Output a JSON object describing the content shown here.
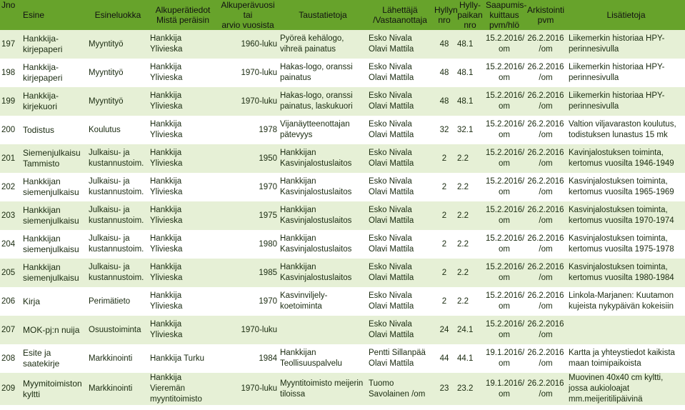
{
  "headers": {
    "jno": "Jno",
    "esine": "Esine",
    "esineluokka": "Esineluokka",
    "alkuperatiedot_1": "Alkuperätiedot",
    "alkuperatiedot_2": "Mistä peräisin",
    "alkuperavuosi_1": "Alkuperävuosi tai",
    "alkuperavuosi_2": "arvio vuosista",
    "taustatietoja": "Taustatietoja",
    "lahettaja_1": "Lähettäjä",
    "lahettaja_2": "/Vastaanottaja",
    "hyllyn_1": "Hyllyn",
    "hyllyn_2": "nro",
    "hyllypaikan_1": "Hylly-",
    "hyllypaikan_2": "paikan",
    "hyllypaikan_3": "nro",
    "saapumis_1": "Saapumis-",
    "saapumis_2": "kuittaus",
    "saapumis_3": "pvm/hlö",
    "arkistointi_1": "Arkistointi",
    "arkistointi_2": "pvm",
    "lisatietoja": "Lisätietoja"
  },
  "rows": [
    {
      "jno": "197",
      "esine": "Hankkija-kirjepaperi",
      "luokka": "Myyntityö",
      "alkupera": "Hankkija Ylivieska",
      "vuosi": "1960-luku",
      "tausta": "Pyöreä kehälogo, vihreä painatus",
      "lahettaja_1": "Esko Nivala",
      "lahettaja_2": "Olavi Mattila",
      "hylly": "48",
      "paikka": "48.1",
      "saapumis_1": "15.2.2016/",
      "saapumis_2": "om",
      "arkisto_1": "26.2.2016",
      "arkisto_2": "/om",
      "lisa": "Liikemerkin historiaa HPY-perinnesivulla"
    },
    {
      "jno": "198",
      "esine": "Hankkija-kirjepaperi",
      "luokka": "Myyntityö",
      "alkupera": "Hankkija Ylivieska",
      "vuosi": "1970-luku",
      "tausta": "Hakas-logo, oranssi painatus",
      "lahettaja_1": "Esko Nivala",
      "lahettaja_2": "Olavi Mattila",
      "hylly": "48",
      "paikka": "48.1",
      "saapumis_1": "15.2.2016/",
      "saapumis_2": "om",
      "arkisto_1": "26.2.2016",
      "arkisto_2": "/om",
      "lisa": "Liikemerkin historiaa HPY-perinnesivulla"
    },
    {
      "jno": "199",
      "esine": "Hankkija-kirjekuori",
      "luokka": "Myyntityö",
      "alkupera": "Hankkija Ylivieska",
      "vuosi": "1970-luku",
      "tausta": "Hakas-logo, oranssi painatus, laskukuori",
      "lahettaja_1": "Esko Nivala",
      "lahettaja_2": "Olavi Mattila",
      "hylly": "48",
      "paikka": "48.1",
      "saapumis_1": "15.2.2016/",
      "saapumis_2": "om",
      "arkisto_1": "26.2.2016",
      "arkisto_2": "/om",
      "lisa": "Liikemerkin historiaa HPY-perinnesivulla"
    },
    {
      "jno": "200",
      "esine": "Todistus",
      "luokka": "Koulutus",
      "alkupera": "Hankkija Ylivieska",
      "vuosi": "1978",
      "tausta": "Vijanäytteenottajan pätevyys",
      "lahettaja_1": "Esko Nivala",
      "lahettaja_2": "Olavi Mattila",
      "hylly": "32",
      "paikka": "32.1",
      "saapumis_1": "15.2.2016/",
      "saapumis_2": "om",
      "arkisto_1": "26.2.2016",
      "arkisto_2": "/om",
      "lisa": "Valtion viljavaraston koulutus, todistuksen lunastus 15 mk"
    },
    {
      "jno": "201",
      "esine": "Siemenjulkaisu Tammisto",
      "luokka": "Julkaisu- ja kustannustoim.",
      "alkupera": "Hankkija Ylivieska",
      "vuosi": "1950",
      "tausta": "Hankkijan Kasvinjalostuslaitos",
      "lahettaja_1": "Esko Nivala",
      "lahettaja_2": "Olavi Mattila",
      "hylly": "2",
      "paikka": "2.2",
      "saapumis_1": "15.2.2016/",
      "saapumis_2": "om",
      "arkisto_1": "26.2.2016",
      "arkisto_2": "/om",
      "lisa": "Kavinjalostuksen toiminta, kertomus vuosilta 1946-1949"
    },
    {
      "jno": "202",
      "esine": "Hankkijan siemenjulkaisu",
      "luokka": "Julkaisu- ja kustannustoim.",
      "alkupera": "Hankkija Ylivieska",
      "vuosi": "1970",
      "tausta": "Hankkijan Kasvinjalostuslaitos",
      "lahettaja_1": "Esko Nivala",
      "lahettaja_2": "Olavi Mattila",
      "hylly": "2",
      "paikka": "2.2",
      "saapumis_1": "15.2.2016/",
      "saapumis_2": "om",
      "arkisto_1": "26.2.2016",
      "arkisto_2": "/om",
      "lisa": "Kasvinjalostuksen toiminta, kertomus vuosilta 1965-1969"
    },
    {
      "jno": "203",
      "esine": "Hankkijan siemenjulkaisu",
      "luokka": "Julkaisu- ja kustannustoim.",
      "alkupera": "Hankkija Ylivieska",
      "vuosi": "1975",
      "tausta": "Hankkijan Kasvinjalostuslaitos",
      "lahettaja_1": "Esko Nivala",
      "lahettaja_2": "Olavi Mattila",
      "hylly": "2",
      "paikka": "2.2",
      "saapumis_1": "15.2.2016/",
      "saapumis_2": "om",
      "arkisto_1": "26.2.2016",
      "arkisto_2": "/om",
      "lisa": "Kasvinjalostuksen toiminta, kertomus vuosilta 1970-1974"
    },
    {
      "jno": "204",
      "esine": "Hankkijan siemenjulkaisu",
      "luokka": "Julkaisu- ja kustannustoim.",
      "alkupera": "Hankkija Ylivieska",
      "vuosi": "1980",
      "tausta": "Hankkijan Kasvinjalostuslaitos",
      "lahettaja_1": "Esko Nivala",
      "lahettaja_2": "Olavi Mattila",
      "hylly": "2",
      "paikka": "2.2",
      "saapumis_1": "15.2.2016/",
      "saapumis_2": "om",
      "arkisto_1": "26.2.2016",
      "arkisto_2": "/om",
      "lisa": "Kasvinjalostuksen toiminta, kertomus vuosilta 1975-1978"
    },
    {
      "jno": "205",
      "esine": "Hankkijan siemenjulkaisu",
      "luokka": "Julkaisu- ja kustannustoim.",
      "alkupera": "Hankkija Ylivieska",
      "vuosi": "1985",
      "tausta": "Hankkijan Kasvinjalostuslaitos",
      "lahettaja_1": "Esko Nivala",
      "lahettaja_2": "Olavi Mattila",
      "hylly": "2",
      "paikka": "2.2",
      "saapumis_1": "15.2.2016/",
      "saapumis_2": "om",
      "arkisto_1": "26.2.2016",
      "arkisto_2": "/om",
      "lisa": "Kasvinjalostuksen toiminta, kertomus vuosilta 1980-1984"
    },
    {
      "jno": "206",
      "esine": "Kirja",
      "luokka": "Perimätieto",
      "alkupera": "Hankkija Ylivieska",
      "vuosi": "1970",
      "tausta": "Kasvinviljely-koetoiminta",
      "lahettaja_1": "Esko Nivala",
      "lahettaja_2": "Olavi Mattila",
      "hylly": "2",
      "paikka": "2.2",
      "saapumis_1": "15.2.2016/",
      "saapumis_2": "om",
      "arkisto_1": "26.2.2016",
      "arkisto_2": "/om",
      "lisa": "Linkola-Marjanen: Kuutamon kujeista nykypäivän kokeisiin"
    },
    {
      "jno": "207",
      "esine": "MOK-pj:n nuija",
      "luokka": "Osuustoiminta",
      "alkupera": "Hankkija Ylivieska",
      "vuosi": "1970-luku",
      "tausta": "",
      "lahettaja_1": "Esko Nivala",
      "lahettaja_2": "Olavi Mattila",
      "hylly": "24",
      "paikka": "24.1",
      "saapumis_1": "15.2.2016/",
      "saapumis_2": "om",
      "arkisto_1": "26.2.2016",
      "arkisto_2": "/om",
      "lisa": ""
    },
    {
      "jno": "208",
      "esine": "Esite ja saatekirje",
      "luokka": "Markkinointi",
      "alkupera": "Hankkija Turku",
      "vuosi": "1984",
      "tausta": "Hankkijan Teollisuuspalvelu",
      "lahettaja_1": "Pentti Sillanpää",
      "lahettaja_2": "Olavi Mattila",
      "hylly": "44",
      "paikka": "44.1",
      "saapumis_1": "19.1.2016/",
      "saapumis_2": "om",
      "arkisto_1": "26.2.2016",
      "arkisto_2": "/om",
      "lisa": "Kartta ja yhteystiedot kaikista maan toimipaikoista"
    },
    {
      "jno": "209",
      "esine": "Myymitoimiston kyltti",
      "luokka": "Markkinointi",
      "alkupera": "Hankkija Vieremän myyntitoimisto",
      "vuosi": "1970-luku",
      "tausta": "Myyntitoimisto meijerin tiloissa",
      "lahettaja_1": "Tuomo",
      "lahettaja_2": "Savolainen /om",
      "hylly": "23",
      "paikka": "23.2",
      "saapumis_1": "19.1.2016/",
      "saapumis_2": "om",
      "arkisto_1": "26.2.2016",
      "arkisto_2": "/om",
      "lisa": "Muovinen 40x40 cm kyltti, jossa aukioloajat mm.meijeritilipäivinä"
    }
  ]
}
